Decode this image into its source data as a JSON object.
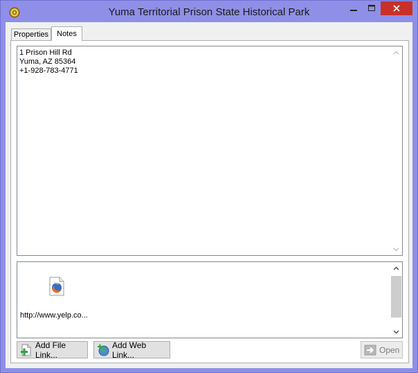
{
  "window": {
    "title": "Yuma Territorial Prison State Historical Park",
    "minimize_icon": "minimize-icon",
    "maximize_icon": "maximize-icon",
    "close_icon": "close-icon",
    "close_color": "#c7312a"
  },
  "tabs": [
    {
      "label": "Properties",
      "selected": false
    },
    {
      "label": "Notes",
      "selected": true
    }
  ],
  "notes": {
    "lines": [
      "1 Prison Hill Rd",
      "Yuma, AZ 85364",
      "+1-928-783-4771"
    ]
  },
  "links": {
    "items": [
      {
        "label": "http://www.yelp.co...",
        "icon": "firefox-icon"
      }
    ]
  },
  "buttons": {
    "add_file_link": "Add File Link...",
    "add_web_link": "Add Web Link...",
    "open": "Open"
  }
}
